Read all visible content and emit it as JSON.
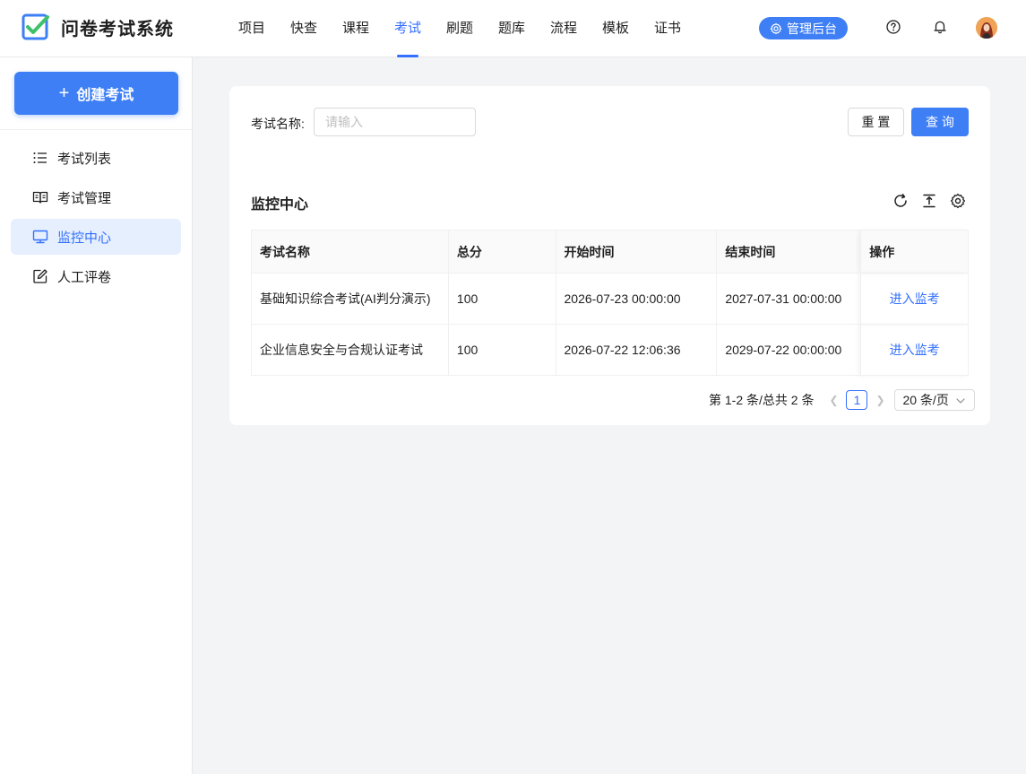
{
  "app": {
    "title": "问卷考试系统",
    "accent_color": "#3370ff"
  },
  "header": {
    "nav": [
      {
        "label": "项目",
        "active": false
      },
      {
        "label": "快查",
        "active": false
      },
      {
        "label": "课程",
        "active": false
      },
      {
        "label": "考试",
        "active": true
      },
      {
        "label": "刷题",
        "active": false
      },
      {
        "label": "题库",
        "active": false
      },
      {
        "label": "流程",
        "active": false
      },
      {
        "label": "模板",
        "active": false
      },
      {
        "label": "证书",
        "active": false
      }
    ],
    "admin_label": "管理后台",
    "icons": [
      "help-circle-icon",
      "bell-icon",
      "user-avatar"
    ]
  },
  "sidebar": {
    "create_label": "创建考试",
    "items": [
      {
        "label": "考试列表",
        "icon": "list-icon",
        "active": false
      },
      {
        "label": "考试管理",
        "icon": "book-icon",
        "active": false
      },
      {
        "label": "监控中心",
        "icon": "monitor-icon",
        "active": true
      },
      {
        "label": "人工评卷",
        "icon": "edit-icon",
        "active": false
      }
    ]
  },
  "search": {
    "label": "考试名称:",
    "placeholder": "请输入",
    "value": "",
    "reset_label": "重 置",
    "query_label": "查 询"
  },
  "table": {
    "title": "监控中心",
    "toolbar_icons": [
      "reload-icon",
      "column-height-icon",
      "setting-icon"
    ],
    "columns": [
      "考试名称",
      "总分",
      "开始时间",
      "结束时间",
      "操作"
    ],
    "rows": [
      {
        "name": "基础知识综合考试(AI判分演示)",
        "score": "100",
        "start": "2026-07-23 00:00:00",
        "end": "2027-07-31 00:00:00",
        "action": "进入监考"
      },
      {
        "name": "企业信息安全与合规认证考试",
        "score": "100",
        "start": "2026-07-22 12:06:36",
        "end": "2029-07-22 00:00:00",
        "action": "进入监考"
      }
    ]
  },
  "pagination": {
    "total_text": "第 1-2 条/总共 2 条",
    "current_page": "1",
    "page_size": "20 条/页"
  }
}
